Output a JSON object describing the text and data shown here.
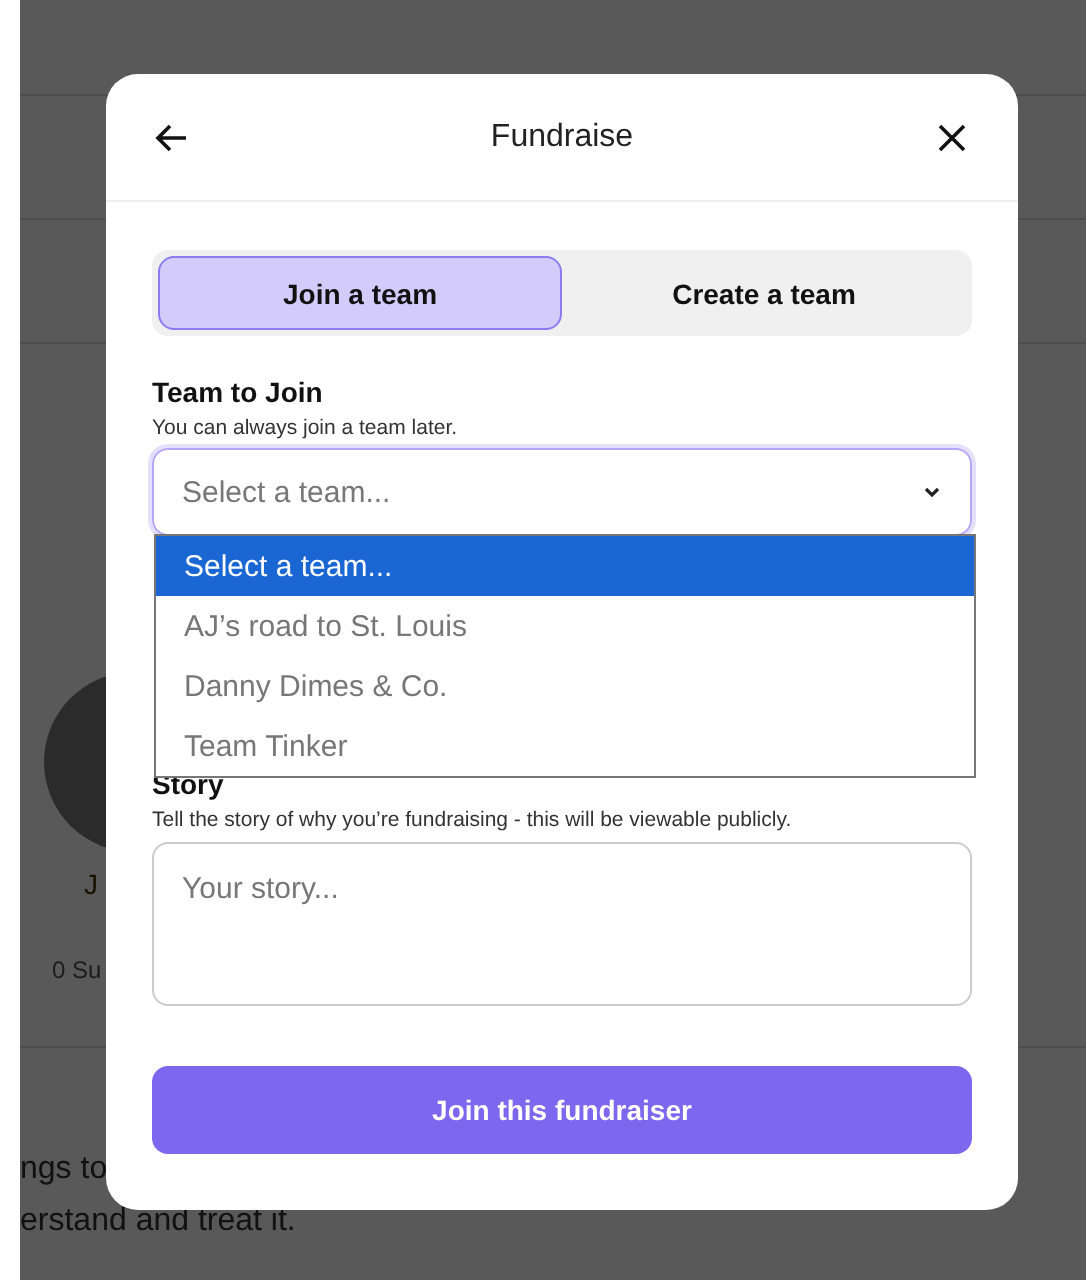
{
  "background_page": {
    "initial": "J",
    "stats": "0 Su",
    "line_1": "ngs to",
    "line_2": "erstand and treat it."
  },
  "dialog": {
    "title": "Fundraise",
    "tabs": [
      {
        "label": "Join a team",
        "selected": true
      },
      {
        "label": "Create a team",
        "selected": false
      }
    ],
    "team_field": {
      "label": "Team to Join",
      "hint": "You can always join a team later.",
      "placeholder": "Select a team...",
      "expanded": true,
      "options": [
        {
          "label": "Select a team...",
          "selected": true
        },
        {
          "label": "AJ’s road to St. Louis",
          "selected": false
        },
        {
          "label": "Danny Dimes & Co.",
          "selected": false
        },
        {
          "label": "Team Tinker",
          "selected": false
        }
      ]
    },
    "story_field": {
      "label": "Story",
      "hint": "Tell the story of why you’re fundraising - this will be viewable publicly.",
      "placeholder": "Your story..."
    },
    "submit_button": "Join this fundraiser"
  }
}
